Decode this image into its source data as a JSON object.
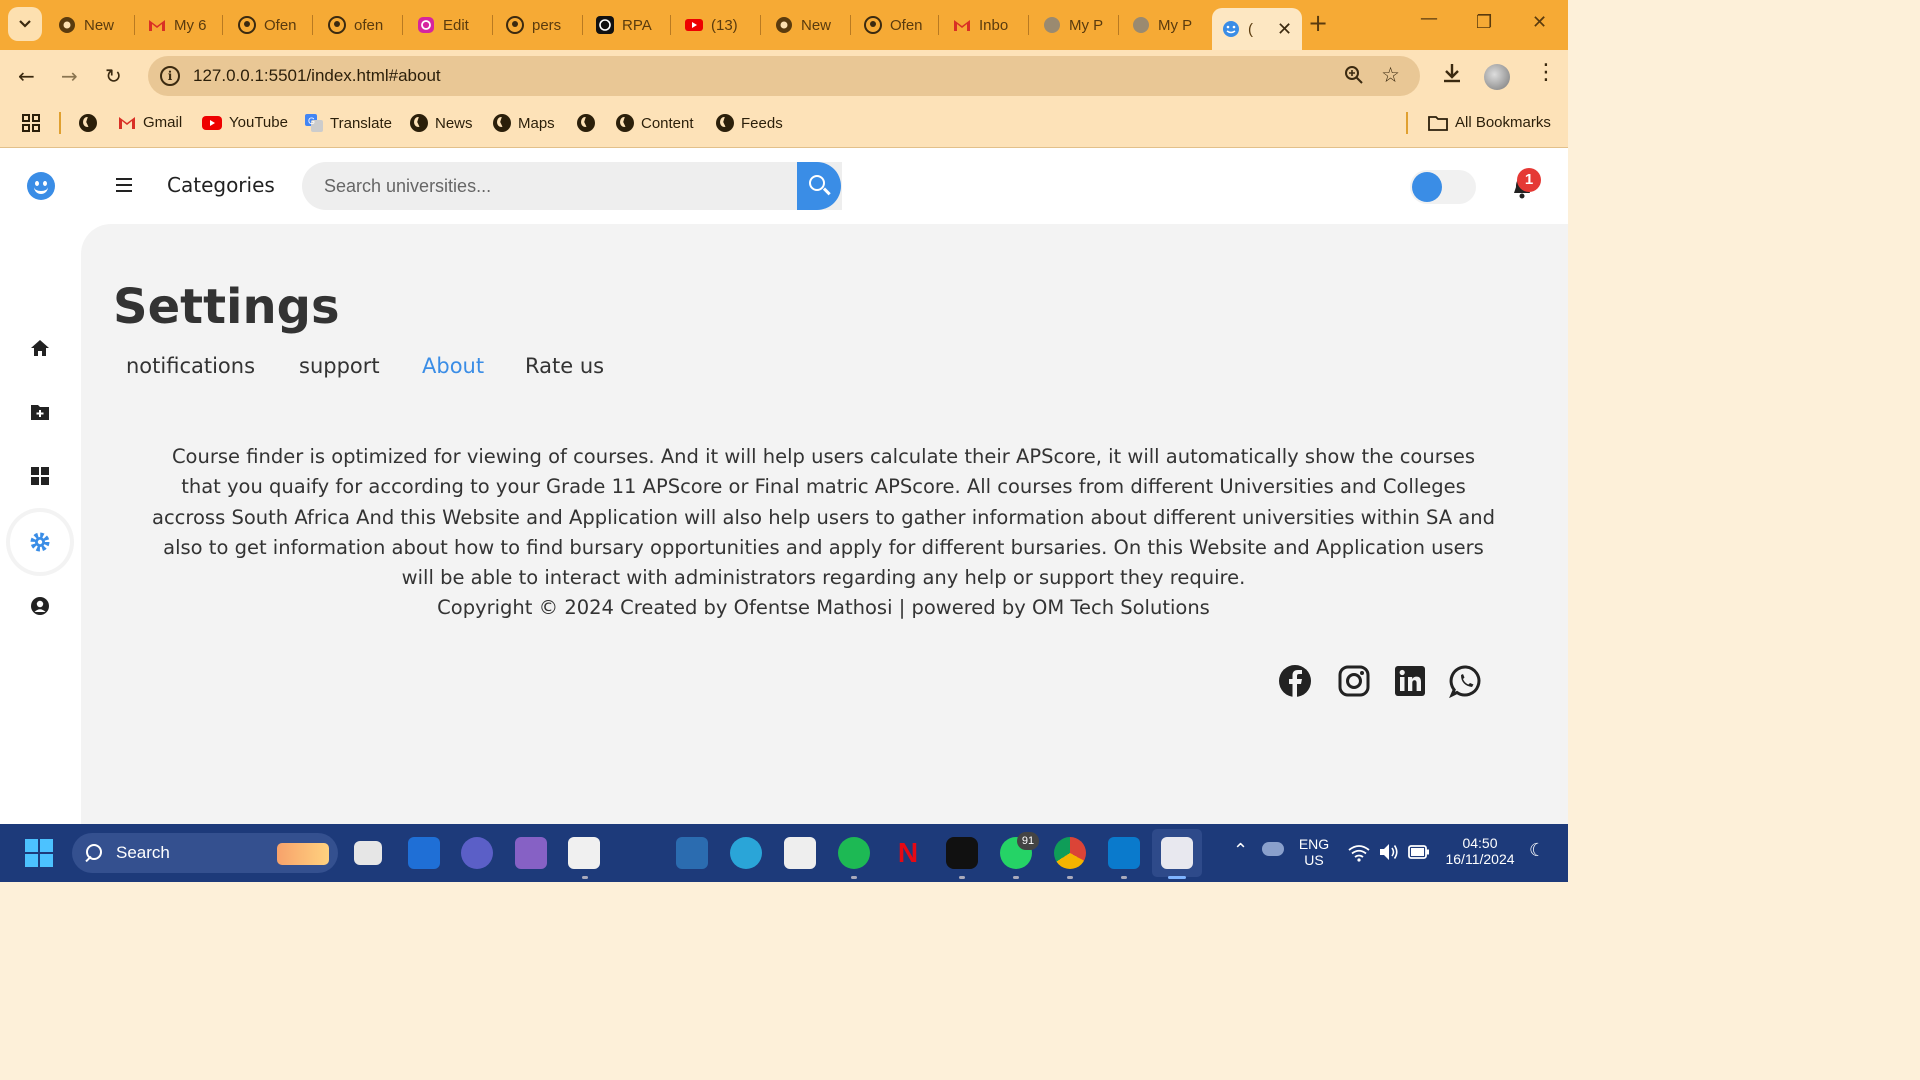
{
  "browser": {
    "tabs": [
      {
        "label": "New",
        "icon": "chrome-icon"
      },
      {
        "label": "My 6",
        "icon": "gmail-icon"
      },
      {
        "label": "Ofen",
        "icon": "github-icon"
      },
      {
        "label": "ofen",
        "icon": "github-icon"
      },
      {
        "label": "Edit",
        "icon": "instagram-icon"
      },
      {
        "label": "pers",
        "icon": "github-icon"
      },
      {
        "label": "RPA",
        "icon": "chatgpt-icon"
      },
      {
        "label": "(13)",
        "icon": "youtube-icon"
      },
      {
        "label": "New",
        "icon": "chrome-icon"
      },
      {
        "label": "Ofen",
        "icon": "github-icon"
      },
      {
        "label": "Inbo",
        "icon": "gmail-icon"
      },
      {
        "label": "My P",
        "icon": "globe-icon"
      },
      {
        "label": "My P",
        "icon": "globe-icon"
      },
      {
        "label": "(",
        "icon": "smiley-icon"
      }
    ],
    "url": "127.0.0.1:5501/index.html#about",
    "bookmarks": {
      "gmail": "Gmail",
      "youtube": "YouTube",
      "translate": "Translate",
      "news": "News",
      "maps": "Maps",
      "content": "Content",
      "feeds": "Feeds",
      "all": "All Bookmarks"
    }
  },
  "app": {
    "header": {
      "categories": "Categories",
      "search_placeholder": "Search universities...",
      "notification_count": "1"
    },
    "settings": {
      "title": "Settings",
      "tabs": [
        "notifications",
        "support",
        "About",
        "Rate us"
      ],
      "active_tab": "About",
      "about_text": "Course finder is optimized for viewing of courses. And it will help users calculate their APScore, it will automatically show the courses that you quaify for according to your Grade 11 APScore or Final matric APScore. All courses from different Universities and Colleges accross South Africa And this Website and Application will also help users to gather information about different universities within SA and also to get information about how to find bursary opportunities and apply for different bursaries. On this Website and Application users will be able to interact with administrators regarding any help or support they require.",
      "copyright": "Copyright © 2024 Created by Ofentse Mathosi | powered by OM Tech Solutions"
    }
  },
  "taskbar": {
    "search_label": "Search",
    "whatsapp_badge": "91",
    "lang_top": "ENG",
    "lang_bottom": "US",
    "time": "04:50",
    "date": "16/11/2024"
  },
  "colors": {
    "accent": "#3a8de6",
    "tabbar": "#f6aa35",
    "badge": "#e53935"
  }
}
